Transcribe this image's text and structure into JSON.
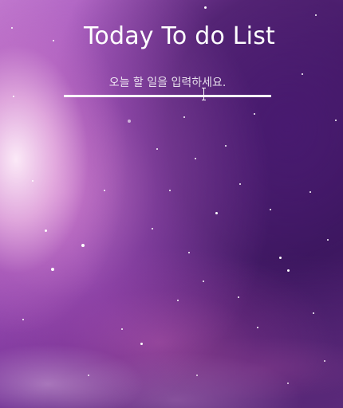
{
  "app": {
    "title": "Today To do List"
  },
  "todo_input": {
    "placeholder": "오늘 할 일을 입력하세요.",
    "value": ""
  }
}
